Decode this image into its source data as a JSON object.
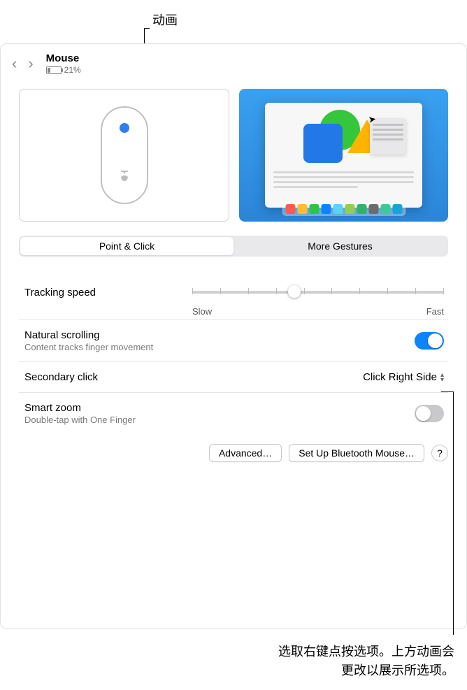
{
  "annotations": {
    "top": "动画",
    "bottom_line1": "选取右键点按选项。上方动画会",
    "bottom_line2": "更改以展示所选项。"
  },
  "header": {
    "title": "Mouse",
    "battery_percent": "21%"
  },
  "tabs": {
    "point_click": "Point & Click",
    "more_gestures": "More Gestures"
  },
  "settings": {
    "tracking": {
      "title": "Tracking speed",
      "slow": "Slow",
      "fast": "Fast"
    },
    "natural_scrolling": {
      "title": "Natural scrolling",
      "sub": "Content tracks finger movement"
    },
    "secondary_click": {
      "title": "Secondary click",
      "value": "Click Right Side"
    },
    "smart_zoom": {
      "title": "Smart zoom",
      "sub": "Double-tap with One Finger"
    }
  },
  "buttons": {
    "advanced": "Advanced…",
    "bluetooth": "Set Up Bluetooth Mouse…",
    "help": "?"
  },
  "dock_colors": [
    "#ff5a52",
    "#ffbd2e",
    "#28c940",
    "#0a84ff",
    "#5ad2fa",
    "#8fd14f",
    "#2fb36a",
    "#6c6c6c",
    "#3fc999",
    "#1aa3d9"
  ]
}
